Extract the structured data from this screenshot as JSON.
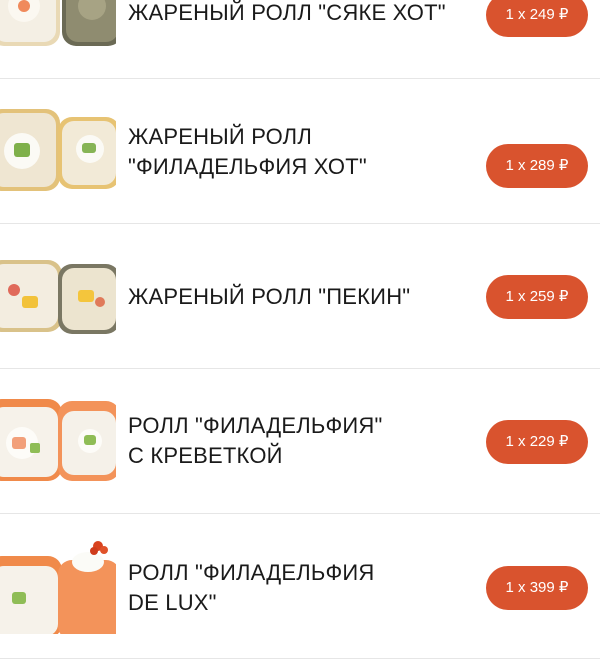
{
  "colors": {
    "accent": "#d9532e",
    "background": "#ffffff",
    "text": "#1a1a1a",
    "divider": "#e6e6e6"
  },
  "products": [
    {
      "name": "ЖАРЕНЫЙ РОЛЛ \"СЯКЕ ХОТ\"",
      "price_label": "1 x 249 ₽",
      "image_icon": "fried-roll-image"
    },
    {
      "name": "ЖАРЕНЫЙ РОЛЛ\n\"ФИЛАДЕЛЬФИЯ ХОТ\"",
      "price_label": "1 x 289 ₽",
      "image_icon": "fried-roll-image"
    },
    {
      "name": "ЖАРЕНЫЙ РОЛЛ \"ПЕКИН\"",
      "price_label": "1 x 259 ₽",
      "image_icon": "fried-roll-image"
    },
    {
      "name": "РОЛЛ \"ФИЛАДЕЛЬФИЯ\"\nС КРЕВЕТКОЙ",
      "price_label": "1 x 229 ₽",
      "image_icon": "salmon-roll-image"
    },
    {
      "name": "РОЛЛ \"ФИЛАДЕЛЬФИЯ\nDE LUX\"",
      "price_label": "1 x 399 ₽",
      "image_icon": "salmon-roll-image"
    }
  ]
}
